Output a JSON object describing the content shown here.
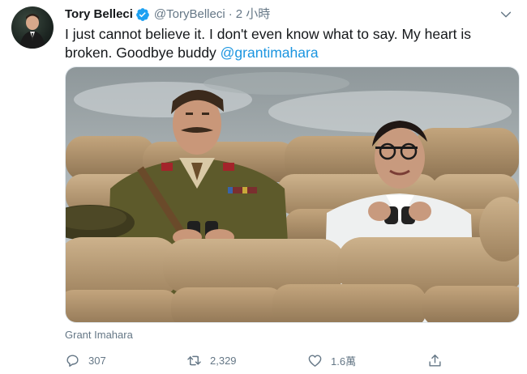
{
  "tweet": {
    "display_name": "Tory Belleci",
    "handle": "@ToryBelleci",
    "separator": "·",
    "timestamp": "2 小時",
    "text_main": "I just cannot believe it. I don't even know what to say. My heart is broken. Goodbye buddy ",
    "mention": "@grantimahara",
    "media_caption": "Grant Imahara",
    "verified": true
  },
  "actions": {
    "reply_count": "307",
    "retweet_count": "2,329",
    "like_count": "1.6萬"
  },
  "icons": {
    "avatar": "avatar",
    "verified": "verified-badge-icon",
    "caret": "chevron-down-icon",
    "reply": "reply-icon",
    "retweet": "retweet-icon",
    "like": "heart-icon",
    "share": "share-icon"
  },
  "colors": {
    "accent": "#1da1f2",
    "mention": "#1b95e0",
    "secondary_text": "#657786",
    "primary_text": "#14171a"
  }
}
